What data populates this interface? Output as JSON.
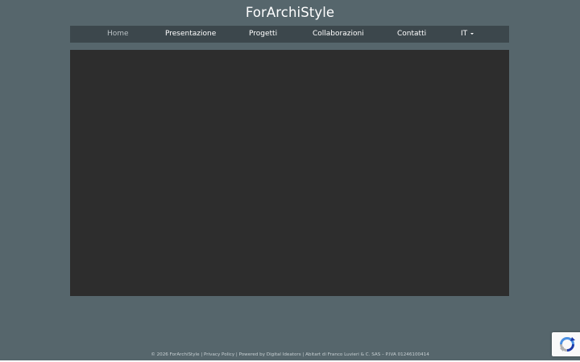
{
  "header": {
    "site_title": "ForArchiStyle"
  },
  "nav": {
    "items": [
      {
        "label": "Home",
        "active": true
      },
      {
        "label": "Presentazione",
        "active": false
      },
      {
        "label": "Progetti",
        "active": false
      },
      {
        "label": "Collaborazioni",
        "active": false
      },
      {
        "label": "Contatti",
        "active": false
      },
      {
        "label": "IT",
        "active": false,
        "dropdown": true
      }
    ]
  },
  "footer": {
    "copyright": "© 2026 ForArchiStyle |",
    "privacy": "Privacy Policy",
    "sep1": "| Powered by",
    "powered_by": "Digital Ideators",
    "company": "| Abitart di Franco Luvieri & C. SAS – P.IVA 01246100414"
  },
  "recaptcha": {
    "icon": "recaptcha-icon"
  },
  "colors": {
    "background": "#56666c",
    "navbar": "#3c474c",
    "panel": "#2d2d2d",
    "nav_active": "#b9c1c4"
  }
}
